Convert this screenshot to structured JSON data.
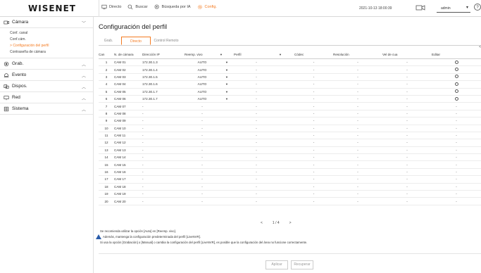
{
  "header": {
    "logo": "WISENET",
    "nav": [
      {
        "label": "Directo",
        "icon": "monitor-icon"
      },
      {
        "label": "Buscar",
        "icon": "search-icon"
      },
      {
        "label": "Búsqueda por IA",
        "icon": "ai-search-icon"
      },
      {
        "label": "Config.",
        "icon": "gear-icon"
      }
    ],
    "datetime": "2021-10-13 18:00:39",
    "user": "admin",
    "help": "?"
  },
  "sidebar": {
    "camera": {
      "label": "Cámara",
      "items": [
        "Conf. canal",
        "Conf.cám.",
        "Configuración del perfil",
        "Contraseña de cámara"
      ]
    },
    "sections": [
      "Grab.",
      "Evento",
      "Dispos.",
      "Red",
      "Sistema"
    ]
  },
  "main": {
    "title": "Configuración del perfil",
    "tabs": [
      "Grab.",
      "Directo",
      "Control Remoto"
    ],
    "scroll_indicator": "<",
    "columns": [
      "Can",
      "N. de cámara",
      "Dirección IP",
      "Reemp. vivo",
      "",
      "Perfil",
      "",
      "Códec",
      "Resolución",
      "Vel de cua",
      "Editar"
    ],
    "rows": [
      {
        "ch": "1",
        "name": "CAM 01",
        "ip": "172.30.1.3",
        "rep": "AUTO",
        "perfil": "-",
        "codec": "-",
        "res": "-",
        "fps": "-",
        "edit": true
      },
      {
        "ch": "2",
        "name": "CAM 02",
        "ip": "172.30.1.4",
        "rep": "AUTO",
        "perfil": "-",
        "codec": "-",
        "res": "-",
        "fps": "-",
        "edit": true
      },
      {
        "ch": "3",
        "name": "CAM 03",
        "ip": "172.30.1.5",
        "rep": "AUTO",
        "perfil": "-",
        "codec": "-",
        "res": "-",
        "fps": "-",
        "edit": true
      },
      {
        "ch": "4",
        "name": "CAM 04",
        "ip": "172.30.1.6",
        "rep": "AUTO",
        "perfil": "-",
        "codec": "-",
        "res": "-",
        "fps": "-",
        "edit": true
      },
      {
        "ch": "5",
        "name": "CAM 05",
        "ip": "172.30.1.7",
        "rep": "AUTO",
        "perfil": "-",
        "codec": "-",
        "res": "-",
        "fps": "-",
        "edit": true
      },
      {
        "ch": "6",
        "name": "CAM 06",
        "ip": "172.30.1.7",
        "rep": "AUTO",
        "perfil": "-",
        "codec": "-",
        "res": "-",
        "fps": "-",
        "edit": true
      },
      {
        "ch": "7",
        "name": "CAM 07",
        "ip": "-",
        "rep": "-",
        "perfil": "-",
        "codec": "-",
        "res": "-",
        "fps": "-",
        "edit": false
      },
      {
        "ch": "8",
        "name": "CAM 08",
        "ip": "-",
        "rep": "-",
        "perfil": "-",
        "codec": "-",
        "res": "-",
        "fps": "-",
        "edit": false
      },
      {
        "ch": "9",
        "name": "CAM 09",
        "ip": "-",
        "rep": "-",
        "perfil": "-",
        "codec": "-",
        "res": "-",
        "fps": "-",
        "edit": false
      },
      {
        "ch": "10",
        "name": "CAM 10",
        "ip": "-",
        "rep": "-",
        "perfil": "-",
        "codec": "-",
        "res": "-",
        "fps": "-",
        "edit": false
      },
      {
        "ch": "11",
        "name": "CAM 11",
        "ip": "-",
        "rep": "-",
        "perfil": "-",
        "codec": "-",
        "res": "-",
        "fps": "-",
        "edit": false
      },
      {
        "ch": "12",
        "name": "CAM 12",
        "ip": "-",
        "rep": "-",
        "perfil": "-",
        "codec": "-",
        "res": "-",
        "fps": "-",
        "edit": false
      },
      {
        "ch": "13",
        "name": "CAM 13",
        "ip": "-",
        "rep": "-",
        "perfil": "-",
        "codec": "-",
        "res": "-",
        "fps": "-",
        "edit": false
      },
      {
        "ch": "14",
        "name": "CAM 14",
        "ip": "-",
        "rep": "-",
        "perfil": "-",
        "codec": "-",
        "res": "-",
        "fps": "-",
        "edit": false
      },
      {
        "ch": "15",
        "name": "CAM 15",
        "ip": "-",
        "rep": "-",
        "perfil": "-",
        "codec": "-",
        "res": "-",
        "fps": "-",
        "edit": false
      },
      {
        "ch": "16",
        "name": "CAM 16",
        "ip": "-",
        "rep": "-",
        "perfil": "-",
        "codec": "-",
        "res": "-",
        "fps": "-",
        "edit": false
      },
      {
        "ch": "17",
        "name": "CAM 17",
        "ip": "-",
        "rep": "-",
        "perfil": "-",
        "codec": "-",
        "res": "-",
        "fps": "-",
        "edit": false
      },
      {
        "ch": "18",
        "name": "CAM 18",
        "ip": "-",
        "rep": "-",
        "perfil": "-",
        "codec": "-",
        "res": "-",
        "fps": "-",
        "edit": false
      },
      {
        "ch": "19",
        "name": "CAM 19",
        "ip": "-",
        "rep": "-",
        "perfil": "-",
        "codec": "-",
        "res": "-",
        "fps": "-",
        "edit": false
      },
      {
        "ch": "20",
        "name": "CAM 20",
        "ip": "-",
        "rep": "-",
        "perfil": "-",
        "codec": "-",
        "res": "-",
        "fps": "-",
        "edit": false
      }
    ],
    "pagination": {
      "prev": "<",
      "page": "1 / 4",
      "next": ">"
    },
    "notes": [
      "Se recomienda utilizar la opción [Auto] en [Reemp. vivo].",
      "Además, mantenga la configuración predeterminada del perfil [LiveNVR].",
      "Si usa la opción [Grabación] o [Manual] o cambia la configuración del perfil [LiveNVR], es posible que la configuración del área no funcione correctamente."
    ],
    "buttons": {
      "apply": "Aplicar",
      "restore": "Recuperar"
    }
  },
  "colors": {
    "accent": "#f47a20",
    "warning": "#2a5caa"
  }
}
